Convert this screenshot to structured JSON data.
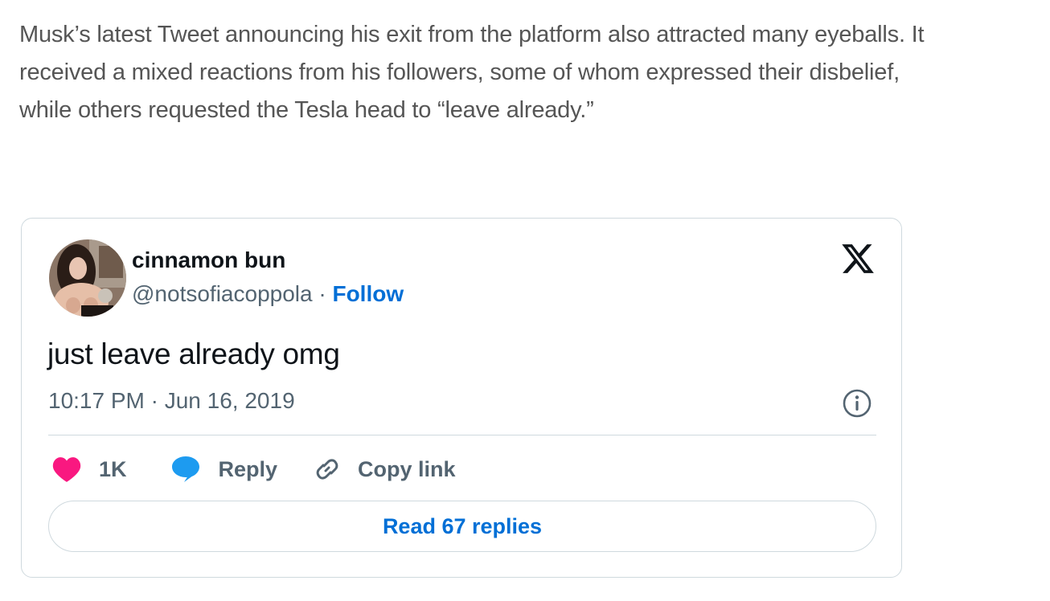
{
  "article": {
    "paragraph_lines": [
      "Musk’s latest Tweet announcing his exit from the platform also attracted many eyeballs. It",
      "received a mixed reactions from his followers, some of whom expressed their disbelief,",
      "while others requested the Tesla head to “leave already.”"
    ]
  },
  "tweet": {
    "display_name": "cinnamon bun",
    "handle": "@notsofiacoppola",
    "separator": " · ",
    "follow_label": "Follow",
    "text": "just leave already omg",
    "timestamp": "10:17 PM · Jun 16, 2019",
    "likes": "1K",
    "reply_label": "Reply",
    "copy_link_label": "Copy link",
    "read_replies_label": "Read 67 replies",
    "icons": {
      "brand": "x-logo-icon",
      "info": "info-icon",
      "like": "heart-icon",
      "reply": "speech-bubble-icon",
      "copy": "link-icon"
    },
    "colors": {
      "like": "#f91880",
      "reply": "#1d9bf0",
      "link": "#006fd6",
      "secondary_text": "#536471",
      "border": "#cfd9de"
    }
  }
}
